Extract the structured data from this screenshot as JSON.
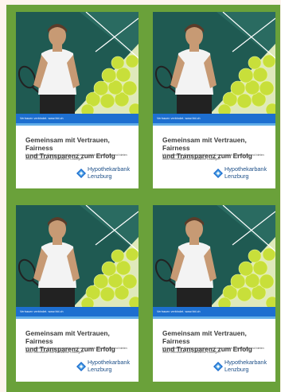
{
  "colors": {
    "sheet": "#6aa13a",
    "bar": "#1d6fd0",
    "bar_light": "#62aee8",
    "photo_bg": "#1f5a52",
    "logo_blue": "#1d4f88"
  },
  "ads": [
    {
      "strip": "Vertrauen verbindet.   www.hbl.ch",
      "headline_1": "Gemeinsam mit Vertrauen, Fairness",
      "headline_2": "und Transparenz zum Erfolg",
      "body": "Mit kompetenter Beratung begleiten wir Sie persönlich sowie digital und bieten Ihnen individuelle und vorbildliche Lösungen.",
      "brand_1": "Hypothekarbank",
      "brand_2": "Lenzburg"
    },
    {
      "strip": "Vertrauen verbindet.   www.hbl.ch",
      "headline_1": "Gemeinsam mit Vertrauen, Fairness",
      "headline_2": "und Transparenz zum Erfolg",
      "body": "Mit kompetenter Beratung begleiten wir Sie persönlich sowie digital und bieten Ihnen individuelle und vorbildliche Lösungen.",
      "brand_1": "Hypothekarbank",
      "brand_2": "Lenzburg"
    },
    {
      "strip": "Vertrauen verbindet.   www.hbl.ch",
      "headline_1": "Gemeinsam mit Vertrauen, Fairness",
      "headline_2": "und Transparenz zum Erfolg",
      "body": "Mit kompetenter Beratung begleiten wir Sie persönlich sowie digital und bieten Ihnen individuelle und vorbildliche Lösungen.",
      "brand_1": "Hypothekarbank",
      "brand_2": "Lenzburg"
    },
    {
      "strip": "Vertrauen verbindet.   www.hbl.ch",
      "headline_1": "Gemeinsam mit Vertrauen, Fairness",
      "headline_2": "und Transparenz zum Erfolg",
      "body": "Mit kompetenter Beratung begleiten wir Sie persönlich sowie digital und bieten Ihnen individuelle und vorbildliche Lösungen.",
      "brand_1": "Hypothekarbank",
      "brand_2": "Lenzburg"
    }
  ]
}
